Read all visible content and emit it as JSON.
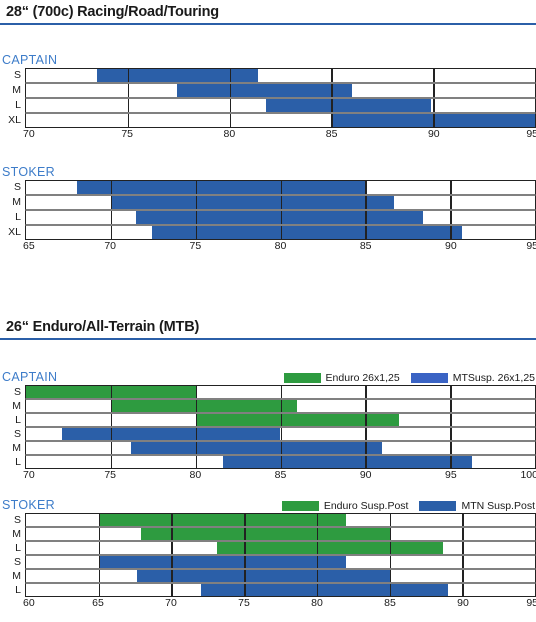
{
  "colors": {
    "blue": "#2b5fa8",
    "blue_light": "#3a63c4",
    "green": "#2e9b40",
    "rule": "#2b5fa8",
    "heading_blue": "#3d7cc9",
    "grid_strong": "#222222",
    "grid_light": "#808080"
  },
  "sections": [
    {
      "title": "28“ (700c) Racing/Road/Touring",
      "charts": [
        {
          "name": "CAPTAIN",
          "legend": [],
          "axis": {
            "min": 70,
            "max": 95,
            "ticks": [
              70,
              75,
              80,
              85,
              90,
              95
            ]
          },
          "rows": [
            {
              "label": "S",
              "bars": [
                {
                  "series": "blue",
                  "start": 73.5,
                  "end": 81.4
                }
              ]
            },
            {
              "label": "M",
              "bars": [
                {
                  "series": "blue",
                  "start": 77.4,
                  "end": 86.0
                }
              ]
            },
            {
              "label": "L",
              "bars": [
                {
                  "series": "blue",
                  "start": 81.8,
                  "end": 89.9
                }
              ]
            },
            {
              "label": "XL",
              "bars": [
                {
                  "series": "blue",
                  "start": 85.0,
                  "end": 95.0
                }
              ]
            }
          ]
        },
        {
          "name": "STOKER",
          "legend": [],
          "axis": {
            "min": 65,
            "max": 95,
            "ticks": [
              65,
              70,
              75,
              80,
              85,
              90,
              95
            ]
          },
          "rows": [
            {
              "label": "S",
              "bars": [
                {
                  "series": "blue",
                  "start": 68.0,
                  "end": 85.0
                }
              ]
            },
            {
              "label": "M",
              "bars": [
                {
                  "series": "blue",
                  "start": 70.0,
                  "end": 86.7
                }
              ]
            },
            {
              "label": "L",
              "bars": [
                {
                  "series": "blue",
                  "start": 71.5,
                  "end": 88.4
                }
              ]
            },
            {
              "label": "XL",
              "bars": [
                {
                  "series": "blue",
                  "start": 72.4,
                  "end": 90.7
                }
              ]
            }
          ]
        }
      ]
    },
    {
      "title": "26“ Enduro/All-Terrain (MTB)",
      "charts": [
        {
          "name": "CAPTAIN",
          "legend": [
            {
              "label": "Enduro 26x1,25",
              "series": "green"
            },
            {
              "label": "MTSusp. 26x1,25",
              "series": "blue_light"
            }
          ],
          "axis": {
            "min": 70,
            "max": 100,
            "ticks": [
              70,
              75,
              80,
              85,
              90,
              95,
              100
            ]
          },
          "rows": [
            {
              "label": "S",
              "bars": [
                {
                  "series": "green",
                  "start": 70.0,
                  "end": 80.0
                }
              ]
            },
            {
              "label": "M",
              "bars": [
                {
                  "series": "green",
                  "start": 75.0,
                  "end": 86.0
                }
              ]
            },
            {
              "label": "L",
              "bars": [
                {
                  "series": "green",
                  "start": 80.0,
                  "end": 92.0
                }
              ],
              "sep": true
            },
            {
              "label": "S",
              "bars": [
                {
                  "series": "blue",
                  "start": 72.1,
                  "end": 85.0
                }
              ]
            },
            {
              "label": "M",
              "bars": [
                {
                  "series": "blue",
                  "start": 76.2,
                  "end": 91.0
                }
              ]
            },
            {
              "label": "L",
              "bars": [
                {
                  "series": "blue",
                  "start": 81.6,
                  "end": 96.3
                }
              ]
            }
          ]
        },
        {
          "name": "STOKER",
          "legend": [
            {
              "label": "Enduro Susp.Post",
              "series": "green"
            },
            {
              "label": "MTN Susp.Post",
              "series": "blue"
            }
          ],
          "axis": {
            "min": 60,
            "max": 95,
            "ticks": [
              60,
              65,
              70,
              75,
              80,
              85,
              90,
              95
            ]
          },
          "rows": [
            {
              "label": "S",
              "bars": [
                {
                  "series": "green",
                  "start": 65.0,
                  "end": 82.0
                }
              ]
            },
            {
              "label": "M",
              "bars": [
                {
                  "series": "green",
                  "start": 67.9,
                  "end": 85.0
                }
              ]
            },
            {
              "label": "L",
              "bars": [
                {
                  "series": "green",
                  "start": 73.1,
                  "end": 88.7
                }
              ],
              "sep": true
            },
            {
              "label": "S",
              "bars": [
                {
                  "series": "blue",
                  "start": 65.0,
                  "end": 82.0
                }
              ]
            },
            {
              "label": "M",
              "bars": [
                {
                  "series": "blue",
                  "start": 67.6,
                  "end": 85.0
                }
              ]
            },
            {
              "label": "L",
              "bars": [
                {
                  "series": "blue",
                  "start": 72.0,
                  "end": 89.0
                }
              ]
            }
          ]
        }
      ]
    }
  ],
  "chart_data": [
    {
      "type": "bar",
      "title": "28“ (700c) Racing/Road/Touring — CAPTAIN",
      "orientation": "horizontal",
      "categories": [
        "S",
        "M",
        "L",
        "XL"
      ],
      "xlabel": "",
      "ylabel": "",
      "xlim": [
        70,
        95
      ],
      "xticks": [
        70,
        75,
        80,
        85,
        90,
        95
      ],
      "grid": true,
      "legend": null,
      "series": [
        {
          "name": "range",
          "color": "#2b5fa8",
          "ranges": [
            [
              73.5,
              81.4
            ],
            [
              77.4,
              86.0
            ],
            [
              81.8,
              89.9
            ],
            [
              85.0,
              95.0
            ]
          ]
        }
      ]
    },
    {
      "type": "bar",
      "title": "28“ (700c) Racing/Road/Touring — STOKER",
      "orientation": "horizontal",
      "categories": [
        "S",
        "M",
        "L",
        "XL"
      ],
      "xlabel": "",
      "ylabel": "",
      "xlim": [
        65,
        95
      ],
      "xticks": [
        65,
        70,
        75,
        80,
        85,
        90,
        95
      ],
      "grid": true,
      "legend": null,
      "series": [
        {
          "name": "range",
          "color": "#2b5fa8",
          "ranges": [
            [
              68.0,
              85.0
            ],
            [
              70.0,
              86.7
            ],
            [
              71.5,
              88.4
            ],
            [
              72.4,
              90.7
            ]
          ]
        }
      ]
    },
    {
      "type": "bar",
      "title": "26“ Enduro/All-Terrain (MTB) — CAPTAIN",
      "orientation": "horizontal",
      "categories": [
        "S",
        "M",
        "L"
      ],
      "xlabel": "",
      "ylabel": "",
      "xlim": [
        70,
        100
      ],
      "xticks": [
        70,
        75,
        80,
        85,
        90,
        95,
        100
      ],
      "grid": true,
      "legend": [
        "Enduro 26x1,25",
        "MTSusp. 26x1,25"
      ],
      "legend_position": "top-right",
      "series": [
        {
          "name": "Enduro 26x1,25",
          "color": "#2e9b40",
          "ranges": [
            [
              70.0,
              80.0
            ],
            [
              75.0,
              86.0
            ],
            [
              80.0,
              92.0
            ]
          ]
        },
        {
          "name": "MTSusp. 26x1,25",
          "color": "#2b5fa8",
          "ranges": [
            [
              72.1,
              85.0
            ],
            [
              76.2,
              91.0
            ],
            [
              81.6,
              96.3
            ]
          ]
        }
      ]
    },
    {
      "type": "bar",
      "title": "26“ Enduro/All-Terrain (MTB) — STOKER",
      "orientation": "horizontal",
      "categories": [
        "S",
        "M",
        "L"
      ],
      "xlabel": "",
      "ylabel": "",
      "xlim": [
        60,
        95
      ],
      "xticks": [
        60,
        65,
        70,
        75,
        80,
        85,
        90,
        95
      ],
      "grid": true,
      "legend": [
        "Enduro Susp.Post",
        "MTN Susp.Post"
      ],
      "legend_position": "top-right",
      "series": [
        {
          "name": "Enduro Susp.Post",
          "color": "#2e9b40",
          "ranges": [
            [
              65.0,
              82.0
            ],
            [
              67.9,
              85.0
            ],
            [
              73.1,
              88.7
            ]
          ]
        },
        {
          "name": "MTN Susp.Post",
          "color": "#2b5fa8",
          "ranges": [
            [
              65.0,
              82.0
            ],
            [
              67.6,
              85.0
            ],
            [
              72.0,
              89.0
            ]
          ]
        }
      ]
    }
  ]
}
